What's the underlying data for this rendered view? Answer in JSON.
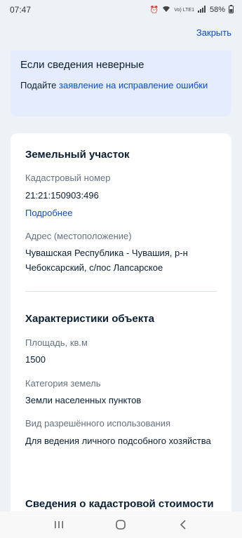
{
  "status_bar": {
    "time": "07:47",
    "network": "Vo) LTE1",
    "battery": "58%"
  },
  "header": {
    "close_label": "Закрыть"
  },
  "error_card": {
    "title": "Если сведения неверные",
    "text_prefix": "Подайте ",
    "link_text": "заявление на исправление ошибки"
  },
  "land_plot": {
    "title": "Земельный участок",
    "cadastral_label": "Кадастровый номер",
    "cadastral_value": "21:21:150903:496",
    "more_link": "Подробнее",
    "address_label": "Адрес (местоположение)",
    "address_value": "Чувашская Республика - Чувашия, р-н Чебоксарский, с/пос Лапсарское"
  },
  "characteristics": {
    "title": "Характеристики объекта",
    "area_label": "Площадь, кв.м",
    "area_value": "1500",
    "category_label": "Категория земель",
    "category_value": "Земли населенных пунктов",
    "usage_label": "Вид разрешённого использования",
    "usage_value": "Для ведения личного подсобного хозяйства"
  },
  "cadastral_cost": {
    "title": "Сведения о кадастровой стоимости"
  },
  "colors": {
    "accent": "#0d4cd3",
    "background": "#edf2f6",
    "info_card": "#e4ecfd"
  }
}
